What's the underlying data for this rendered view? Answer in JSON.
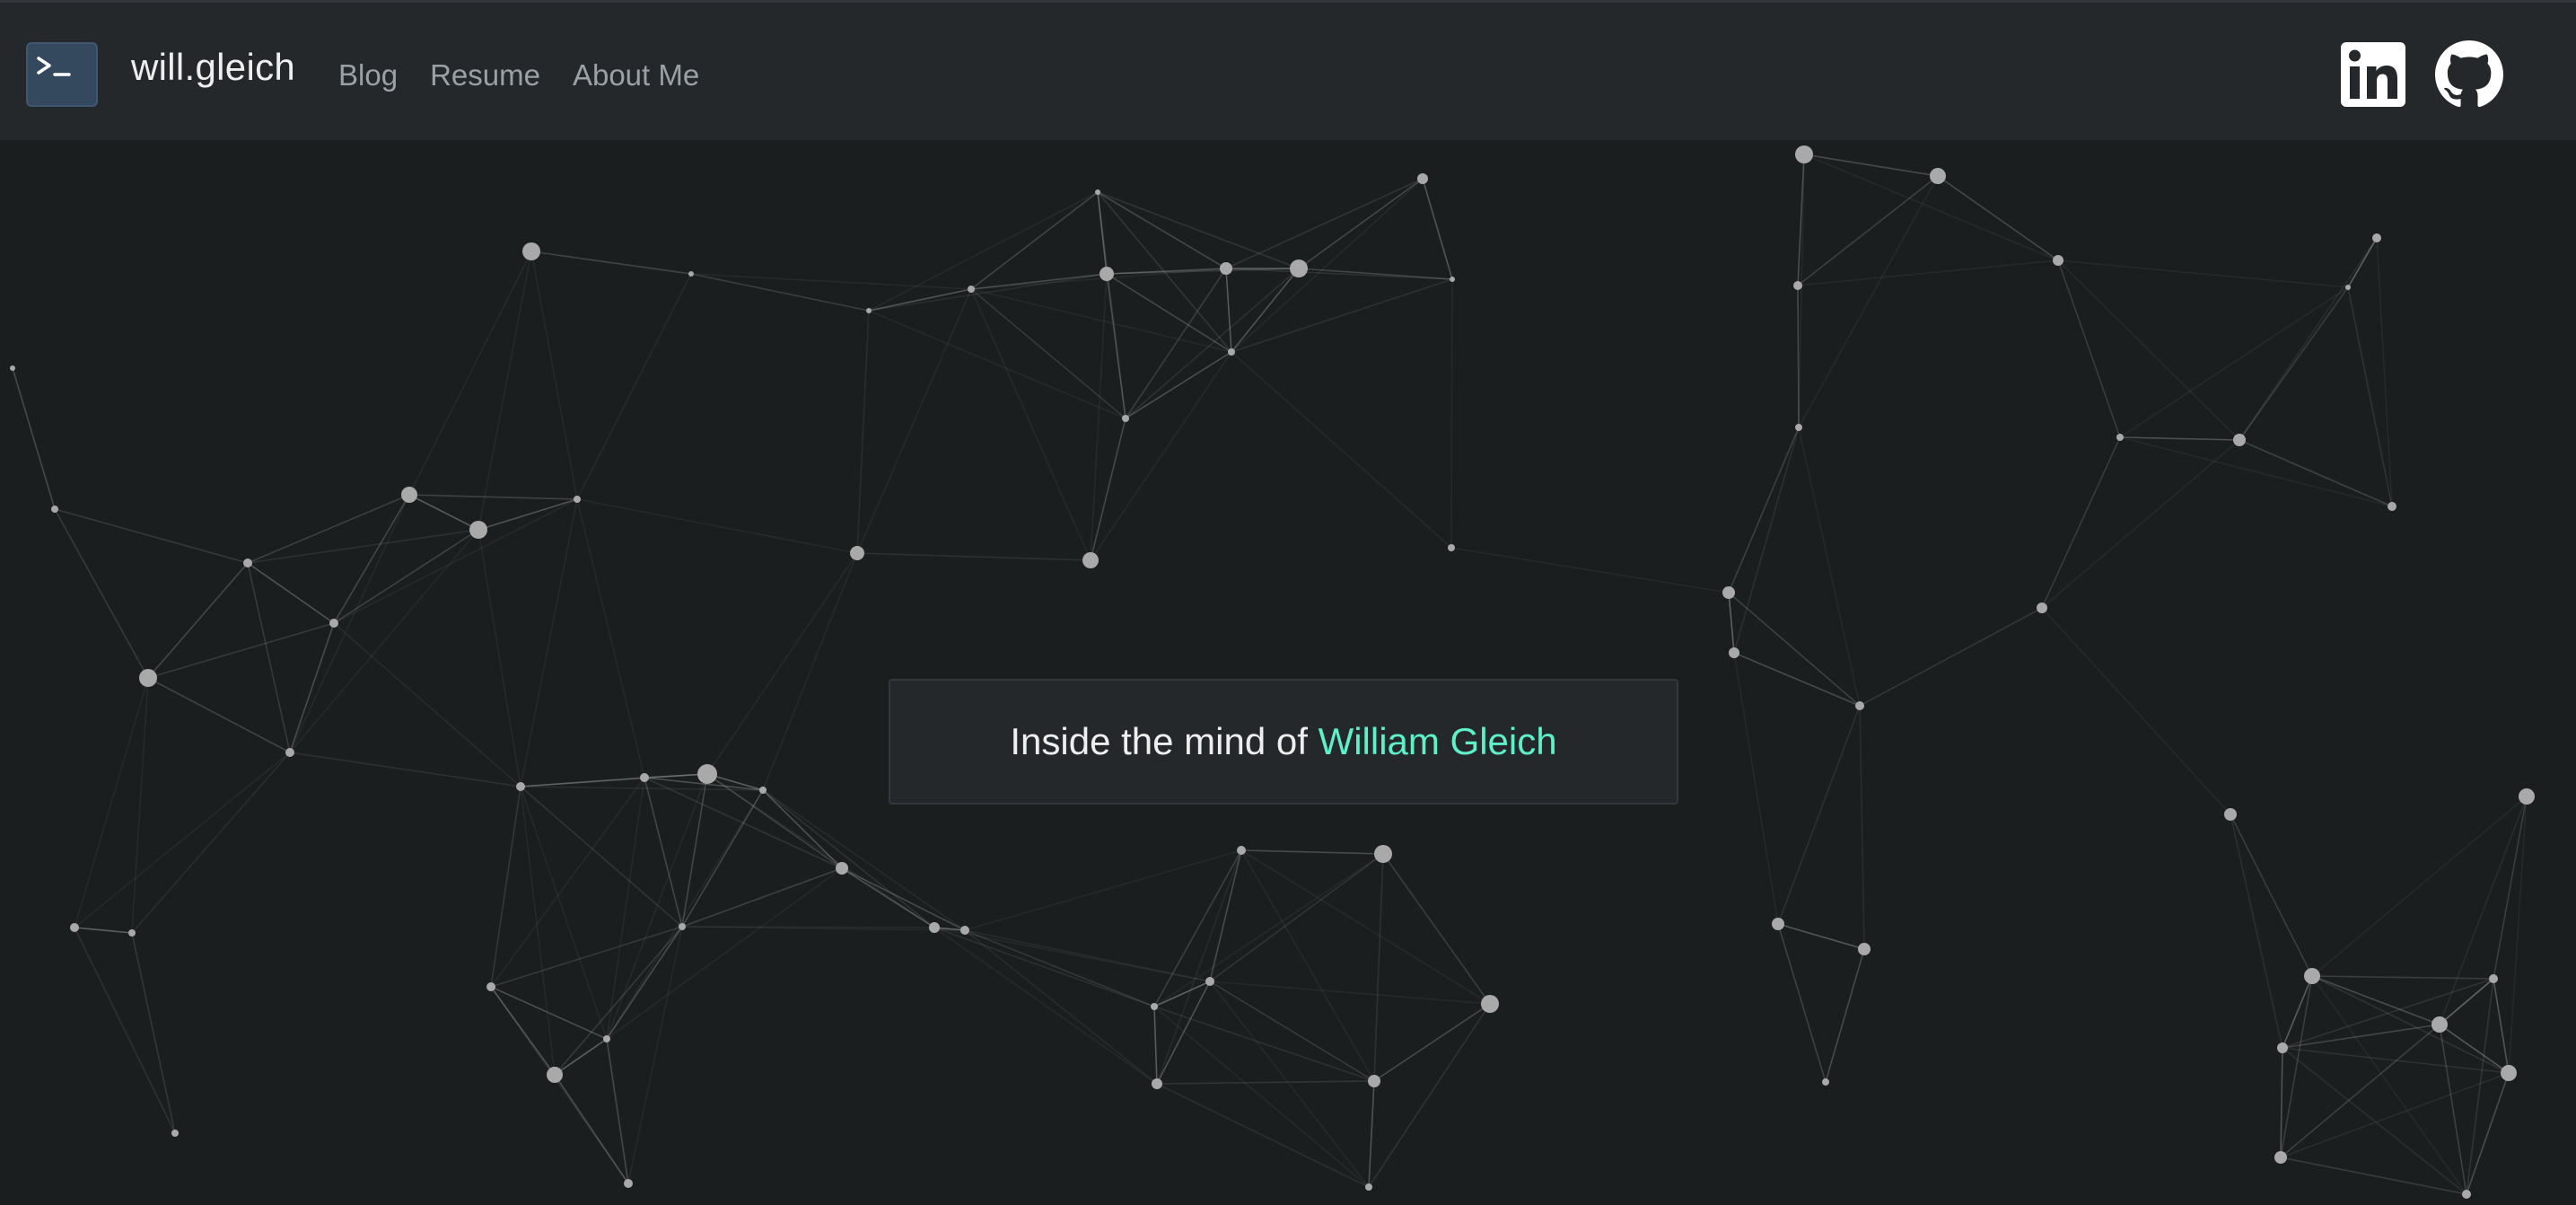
{
  "header": {
    "logo_icon": "terminal-icon",
    "brand": "will.gleich",
    "nav": [
      {
        "label": "Blog"
      },
      {
        "label": "Resume"
      },
      {
        "label": "About Me"
      }
    ],
    "social": [
      {
        "icon": "linkedin-icon"
      },
      {
        "icon": "github-icon"
      }
    ]
  },
  "hero": {
    "prefix": "Inside the mind of ",
    "name": "William Gleich"
  },
  "colors": {
    "background": "#1b1e1f",
    "navbar": "#25282b",
    "accent": "#5ef0c9",
    "logo": "#34495e"
  }
}
